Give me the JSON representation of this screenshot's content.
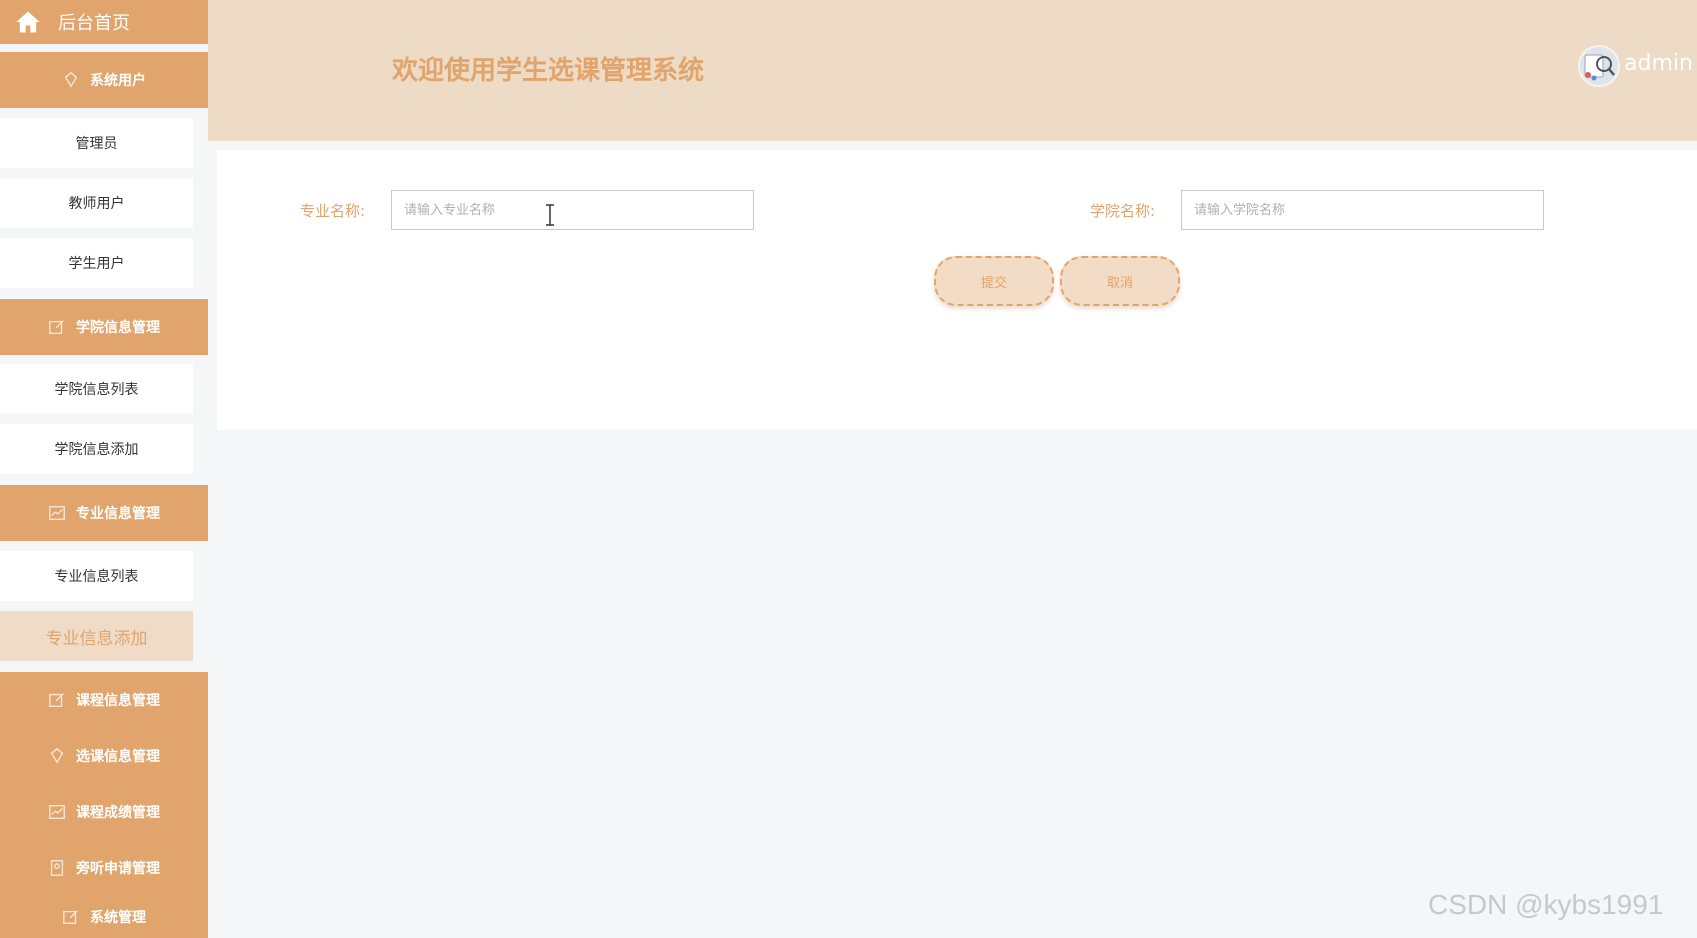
{
  "sidebar": {
    "home_label": "后台首页",
    "groups": [
      {
        "label": "系统用户",
        "icon": "diamond-icon"
      },
      {
        "label": "学院信息管理",
        "icon": "edit-icon"
      },
      {
        "label": "专业信息管理",
        "icon": "chart-icon"
      },
      {
        "label": "课程信息管理",
        "icon": "edit-icon"
      },
      {
        "label": "选课信息管理",
        "icon": "diamond-icon"
      },
      {
        "label": "课程成绩管理",
        "icon": "chart-icon"
      },
      {
        "label": "旁听申请管理",
        "icon": "badge-icon"
      },
      {
        "label": "系统管理",
        "icon": "edit-icon"
      }
    ],
    "items": [
      {
        "label": "管理员"
      },
      {
        "label": "教师用户"
      },
      {
        "label": "学生用户"
      },
      {
        "label": "学院信息列表"
      },
      {
        "label": "学院信息添加"
      },
      {
        "label": "专业信息列表"
      },
      {
        "label": "专业信息添加",
        "active": true
      }
    ]
  },
  "header": {
    "title": "欢迎使用学生选课管理系统",
    "username": "admin"
  },
  "form": {
    "major_label": "专业名称:",
    "major_placeholder": "请输入专业名称",
    "major_value": "",
    "college_label": "学院名称:",
    "college_placeholder": "请输入学院名称",
    "college_value": "",
    "submit_label": "提交",
    "cancel_label": "取消"
  },
  "watermark": "CSDN @kybs1991",
  "colors": {
    "accent": "#e0a46c",
    "header_bg": "#eddbc6",
    "active_item_bg": "#f0dcc6"
  }
}
